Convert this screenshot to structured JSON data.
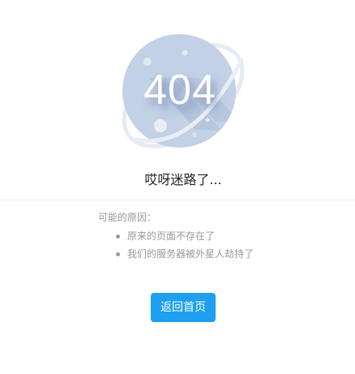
{
  "error": {
    "code": "404",
    "title": "哎呀迷路了..."
  },
  "reasons": {
    "heading": "可能的原因：",
    "items": [
      "原来的页面不存在了",
      "我们的服务器被外星人劫持了"
    ]
  },
  "actions": {
    "home_label": "返回首页"
  },
  "colors": {
    "planet": "#c3d1e6",
    "ring": "#e3e9f2",
    "primary_button": "#1e9fef",
    "muted_text": "#999999",
    "title_text": "#222222"
  },
  "icons": {
    "illustration": "planet-404-illustration-icon"
  }
}
